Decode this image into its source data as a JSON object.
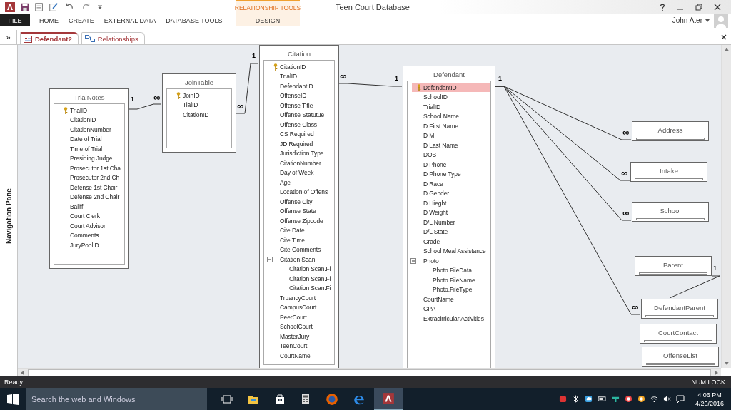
{
  "window": {
    "title": "Teen Court Database",
    "user": "John Ater"
  },
  "contextual_tab_group": "RELATIONSHIP TOOLS",
  "ribbon_tabs": [
    {
      "label": "FILE",
      "kind": "file",
      "selected": false
    },
    {
      "label": "HOME",
      "kind": "tab",
      "selected": false
    },
    {
      "label": "CREATE",
      "kind": "tab",
      "selected": false
    },
    {
      "label": "EXTERNAL DATA",
      "kind": "tab",
      "selected": false
    },
    {
      "label": "DATABASE TOOLS",
      "kind": "tab",
      "selected": false
    },
    {
      "label": "DESIGN",
      "kind": "contextual",
      "selected": false
    }
  ],
  "document_tabs": [
    {
      "label": "Defendant2",
      "kind": "form",
      "selected": true
    },
    {
      "label": "Relationships",
      "kind": "relationships",
      "selected": false
    }
  ],
  "navigation_pane": {
    "label": "Navigation Pane",
    "toggle": "»"
  },
  "tables": [
    {
      "name": "TrialNotes",
      "fields": [
        {
          "name": "TrialID",
          "primary_key": true,
          "selected": false
        },
        {
          "name": "CitationID",
          "primary_key": false,
          "selected": false
        },
        {
          "name": "CitationNumber",
          "primary_key": false,
          "selected": false
        },
        {
          "name": "Date of Trial",
          "primary_key": false,
          "selected": false
        },
        {
          "name": "Time of Trial",
          "primary_key": false,
          "selected": false
        },
        {
          "name": "Presiding Judge",
          "primary_key": false,
          "selected": false
        },
        {
          "name": "Prosecutor 1st Cha",
          "primary_key": false,
          "selected": false
        },
        {
          "name": "Prosecutor 2nd Ch",
          "primary_key": false,
          "selected": false
        },
        {
          "name": "Defense 1st Chair",
          "primary_key": false,
          "selected": false
        },
        {
          "name": "Defense 2nd Chair",
          "primary_key": false,
          "selected": false
        },
        {
          "name": "Baliff",
          "primary_key": false,
          "selected": false
        },
        {
          "name": "Court Clerk",
          "primary_key": false,
          "selected": false
        },
        {
          "name": "Court Advisor",
          "primary_key": false,
          "selected": false
        },
        {
          "name": "Comments",
          "primary_key": false,
          "selected": false
        },
        {
          "name": "JuryPoolID",
          "primary_key": false,
          "selected": false
        }
      ]
    },
    {
      "name": "JoinTable",
      "fields": [
        {
          "name": "JoinID",
          "primary_key": true,
          "selected": false
        },
        {
          "name": "TialID",
          "primary_key": false,
          "selected": false
        },
        {
          "name": "CitationID",
          "primary_key": false,
          "selected": false
        }
      ]
    },
    {
      "name": "Citation",
      "fields": [
        {
          "name": "CitationID",
          "primary_key": true,
          "selected": false
        },
        {
          "name": "TrialID",
          "primary_key": false,
          "selected": false
        },
        {
          "name": "DefendantID",
          "primary_key": false,
          "selected": false
        },
        {
          "name": "OffenseID",
          "primary_key": false,
          "selected": false
        },
        {
          "name": "Offense Title",
          "primary_key": false,
          "selected": false
        },
        {
          "name": "Offense Statutue",
          "primary_key": false,
          "selected": false
        },
        {
          "name": "Offense Class",
          "primary_key": false,
          "selected": false
        },
        {
          "name": "CS Required",
          "primary_key": false,
          "selected": false
        },
        {
          "name": "JD Required",
          "primary_key": false,
          "selected": false
        },
        {
          "name": "Jurisdiction Type",
          "primary_key": false,
          "selected": false
        },
        {
          "name": "CitationNumber",
          "primary_key": false,
          "selected": false
        },
        {
          "name": "Day of Week",
          "primary_key": false,
          "selected": false
        },
        {
          "name": "Age",
          "primary_key": false,
          "selected": false
        },
        {
          "name": "Location of Offens",
          "primary_key": false,
          "selected": false
        },
        {
          "name": "Offense City",
          "primary_key": false,
          "selected": false
        },
        {
          "name": "Offense State",
          "primary_key": false,
          "selected": false
        },
        {
          "name": "Offense Zipcode",
          "primary_key": false,
          "selected": false
        },
        {
          "name": "Cite Date",
          "primary_key": false,
          "selected": false
        },
        {
          "name": "Cite Time",
          "primary_key": false,
          "selected": false
        },
        {
          "name": "Cite Comments",
          "primary_key": false,
          "selected": false
        },
        {
          "name": "Citation Scan",
          "primary_key": false,
          "selected": false,
          "expanded": true,
          "children": [
            {
              "name": "Citation Scan.Fi",
              "primary_key": false,
              "selected": false
            },
            {
              "name": "Citation Scan.Fi",
              "primary_key": false,
              "selected": false
            },
            {
              "name": "Citation Scan.Fi",
              "primary_key": false,
              "selected": false
            }
          ]
        },
        {
          "name": "TruancyCourt",
          "primary_key": false,
          "selected": false
        },
        {
          "name": "CampusCourt",
          "primary_key": false,
          "selected": false
        },
        {
          "name": "PeerCourt",
          "primary_key": false,
          "selected": false
        },
        {
          "name": "SchoolCourt",
          "primary_key": false,
          "selected": false
        },
        {
          "name": "MasterJury",
          "primary_key": false,
          "selected": false
        },
        {
          "name": "TeenCourt",
          "primary_key": false,
          "selected": false
        },
        {
          "name": "CourtName",
          "primary_key": false,
          "selected": false
        }
      ]
    },
    {
      "name": "Defendant",
      "fields": [
        {
          "name": "DefendantID",
          "primary_key": true,
          "selected": true
        },
        {
          "name": "SchoolID",
          "primary_key": false,
          "selected": false
        },
        {
          "name": "TrialID",
          "primary_key": false,
          "selected": false
        },
        {
          "name": "School Name",
          "primary_key": false,
          "selected": false
        },
        {
          "name": "D First Name",
          "primary_key": false,
          "selected": false
        },
        {
          "name": "D MI",
          "primary_key": false,
          "selected": false
        },
        {
          "name": "D Last Name",
          "primary_key": false,
          "selected": false
        },
        {
          "name": "DOB",
          "primary_key": false,
          "selected": false
        },
        {
          "name": "D Phone",
          "primary_key": false,
          "selected": false
        },
        {
          "name": "D Phone Type",
          "primary_key": false,
          "selected": false
        },
        {
          "name": "D Race",
          "primary_key": false,
          "selected": false
        },
        {
          "name": "D Gender",
          "primary_key": false,
          "selected": false
        },
        {
          "name": "D Hieght",
          "primary_key": false,
          "selected": false
        },
        {
          "name": "D Weight",
          "primary_key": false,
          "selected": false
        },
        {
          "name": "D/L Number",
          "primary_key": false,
          "selected": false
        },
        {
          "name": "D/L State",
          "primary_key": false,
          "selected": false
        },
        {
          "name": "Grade",
          "primary_key": false,
          "selected": false
        },
        {
          "name": "School Meal Assistance",
          "primary_key": false,
          "selected": false
        },
        {
          "name": "Photo",
          "primary_key": false,
          "selected": false,
          "expanded": true,
          "children": [
            {
              "name": "Photo.FileData",
              "primary_key": false,
              "selected": false
            },
            {
              "name": "Photo.FileName",
              "primary_key": false,
              "selected": false
            },
            {
              "name": "Photo.FileType",
              "primary_key": false,
              "selected": false
            }
          ]
        },
        {
          "name": "CourtName",
          "primary_key": false,
          "selected": false
        },
        {
          "name": "GPA",
          "primary_key": false,
          "selected": false
        },
        {
          "name": "Extracirricular Activities",
          "primary_key": false,
          "selected": false
        }
      ]
    },
    {
      "name": "Address"
    },
    {
      "name": "Intake"
    },
    {
      "name": "School"
    },
    {
      "name": "Parent"
    },
    {
      "name": "DefendantParent"
    },
    {
      "name": "CourtContact"
    },
    {
      "name": "OffenseList"
    }
  ],
  "relationships": [
    {
      "one": "1",
      "many": "∞"
    },
    {
      "one": "1",
      "many": "∞"
    },
    {
      "one": "1",
      "many": "∞"
    },
    {
      "one": "1",
      "many": "∞"
    },
    {
      "many": "∞"
    },
    {
      "many": "∞"
    },
    {
      "many": "∞"
    },
    {
      "one": "1"
    }
  ],
  "status_bar": {
    "left": "Ready",
    "right": "NUM LOCK"
  },
  "taskbar": {
    "search_placeholder": "Search the web and Windows",
    "time": "4:06 PM",
    "date": "4/20/2016"
  }
}
